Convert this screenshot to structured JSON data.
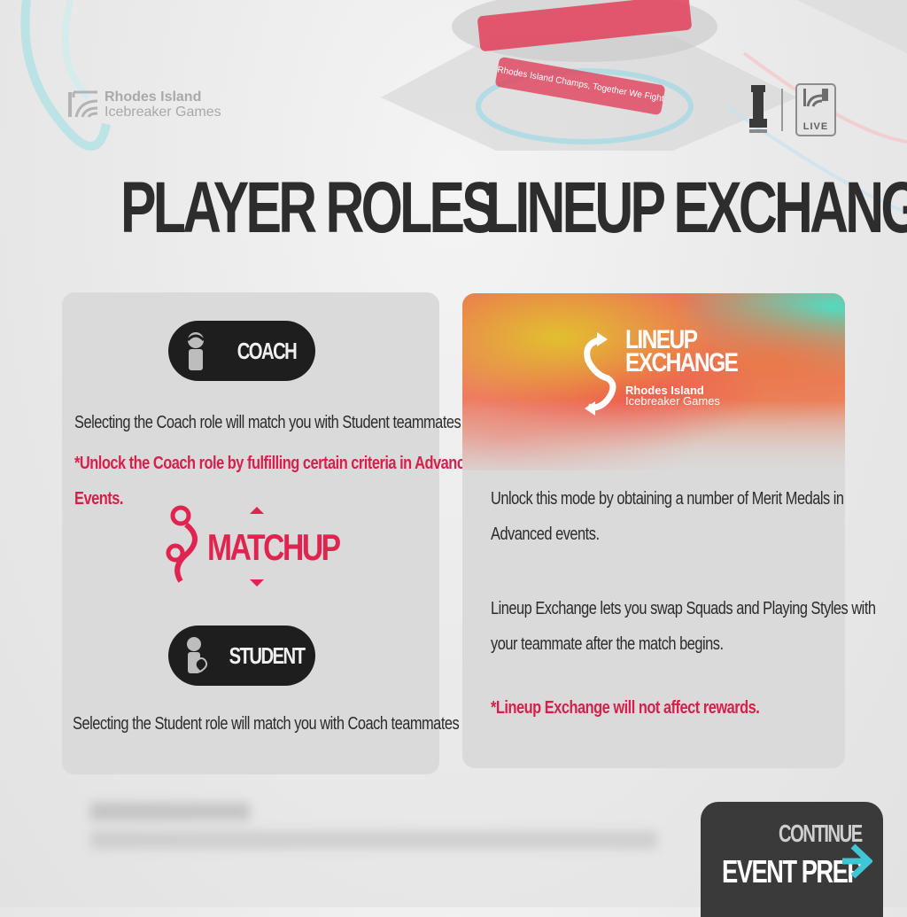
{
  "brand": {
    "line1": "Rhodes Island",
    "line2": "Icebreaker Games"
  },
  "arena": {
    "ring_text": "Rhodes Island Champs, Together We Fight"
  },
  "header": {
    "left_title": "PLAYER ROLES",
    "right_title": "LINEUP EXCHANGE"
  },
  "status": {
    "live_label": "LIVE"
  },
  "roles": {
    "coach_label": "COACH",
    "coach_desc": "Selecting the Coach role will match you with Student teammates only.",
    "coach_unlock_line1": "*Unlock the Coach role by fulfilling certain criteria in Advanced",
    "coach_unlock_line2": "Events.",
    "matchup_label": "MATCHUP",
    "student_label": "STUDENT",
    "student_desc": "Selecting the Student role will match you with Coach teammates only."
  },
  "lineup": {
    "logo_line1": "LINEUP",
    "logo_line2": "EXCHANGE",
    "logo_sub1": "Rhodes Island",
    "logo_sub2": "Icebreaker Games",
    "p1_line1": "Unlock this mode by obtaining a number of Merit Medals in",
    "p1_line2": "Advanced events.",
    "p2_line1": "Lineup Exchange lets you swap Squads and Playing Styles with",
    "p2_line2": "your teammate after the match begins.",
    "note": "*Lineup Exchange will not affect rewards."
  },
  "footer": {
    "continue_label": "CONTINUE",
    "event_prep_label": "EVENT PREP"
  },
  "colors": {
    "accent_red": "#d61f4a",
    "pill_bg": "#1e1e1e",
    "arrow_cyan": "#3fc7d8"
  }
}
